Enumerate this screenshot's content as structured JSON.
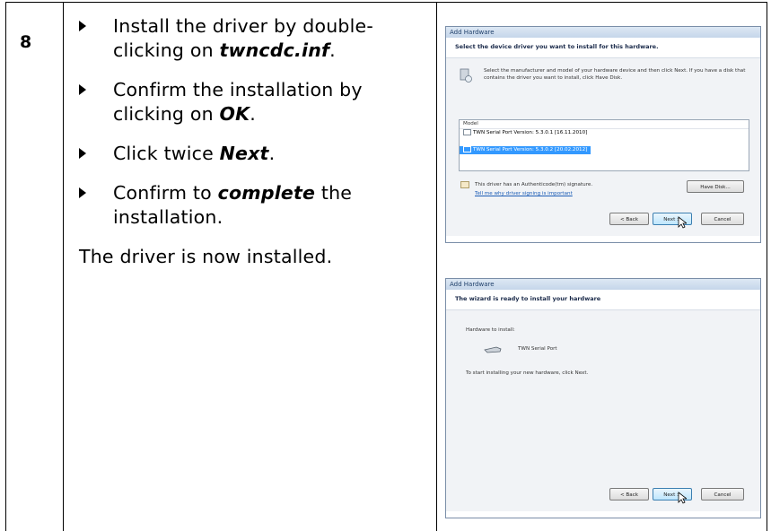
{
  "step": {
    "number": "8"
  },
  "instructions": [
    {
      "pre": "Install the driver by double-clicking on ",
      "em": "twncdc.inf",
      "post": "."
    },
    {
      "pre": "Confirm the installation by clicking on ",
      "em": "OK",
      "post": "."
    },
    {
      "pre": "Click twice ",
      "em": "Next",
      "post": "."
    },
    {
      "pre": "Confirm to ",
      "em": "complete",
      "post": " the installation."
    }
  ],
  "note": "The driver is now installed.",
  "dialog1": {
    "title": "Add Hardware",
    "heading": "Select the device driver you want to install for this hardware.",
    "description": "Select the manufacturer and model of your hardware device and then click Next. If you have a disk that contains the driver you want to install, click Have Disk.",
    "model_header": "Model",
    "models": [
      "TWN Serial Port Version: 5.3.0.1 [16.11.2010]",
      "TWN Serial Port Version: 5.3.0.2 [20.02.2012]"
    ],
    "signature_text": "This driver has an Authenticode(tm) signature.",
    "signature_link": "Tell me why driver signing is important",
    "have_disk": "Have Disk...",
    "back": "< Back",
    "next": "Next >",
    "cancel": "Cancel"
  },
  "dialog2": {
    "title": "Add Hardware",
    "heading": "The wizard is ready to install your hardware",
    "hardware_label": "Hardware to install:",
    "device": "TWN Serial Port",
    "instruction": "To start installing your new hardware, click Next.",
    "back": "< Back",
    "next": "Next >",
    "cancel": "Cancel"
  }
}
